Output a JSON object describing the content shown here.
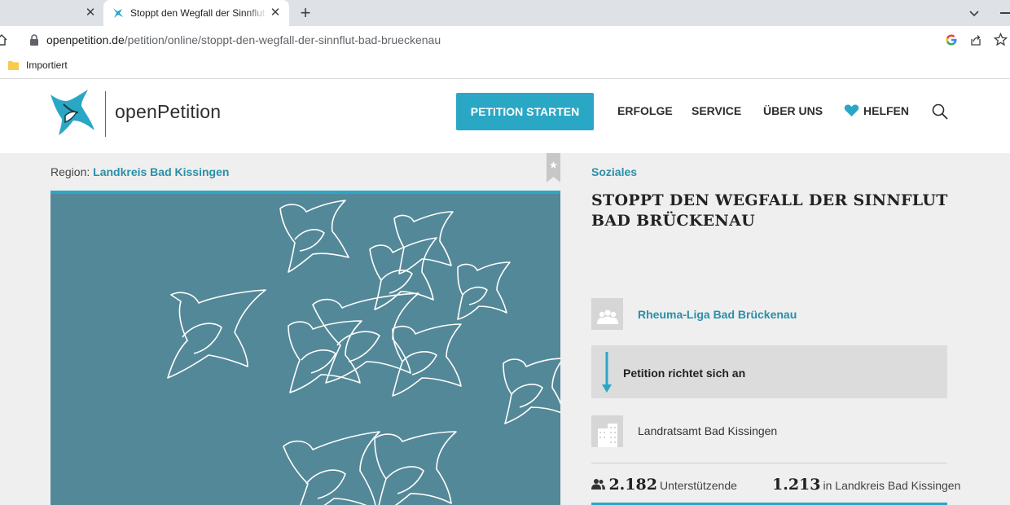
{
  "browser": {
    "active_tab_title": "Stoppt den Wegfall der Sinnflut Bad Brückenau",
    "tab_close_glyph": "✕",
    "new_tab_glyph": "+",
    "url_host": "openpetition.de",
    "url_path": "/petition/online/stoppt-den-wegfall-der-sinnflut-bad-brueckenau",
    "bookmark_folder": "Importiert"
  },
  "site": {
    "logo_text": "openPetition",
    "nav": {
      "start_button": "PETITION STARTEN",
      "erfolge": "ERFOLGE",
      "service": "SERVICE",
      "ueber_uns": "ÜBER UNS",
      "helfen": "HELFEN"
    }
  },
  "petition": {
    "region_label": "Region:",
    "region": "Landkreis Bad Kissingen",
    "category": "Soziales",
    "title": "STOPPT DEN WEGFALL DER SINNFLUT BAD BRÜCKENAU",
    "organizer": "Rheuma-Liga Bad Brückenau",
    "addressee_label": "Petition richtet sich an",
    "addressee": "Landratsamt Bad Kissingen",
    "supporters_count": "2.182",
    "supporters_label": "Unterstützende",
    "region_count": "1.213",
    "region_count_label": "in Landkreis Bad Kissingen"
  },
  "colors": {
    "accent": "#2aa7c5",
    "link": "#2a8fa8",
    "hero_bg": "#538898",
    "page_bg": "#efefef"
  },
  "icons": [
    "home-icon",
    "lock-icon",
    "google-icon",
    "share-icon",
    "star-icon",
    "folder-icon",
    "heart-icon",
    "search-icon",
    "bookmark-ribbon-icon",
    "arrow-down-icon",
    "people-icon",
    "building-icon",
    "group-avatar-icon"
  ]
}
